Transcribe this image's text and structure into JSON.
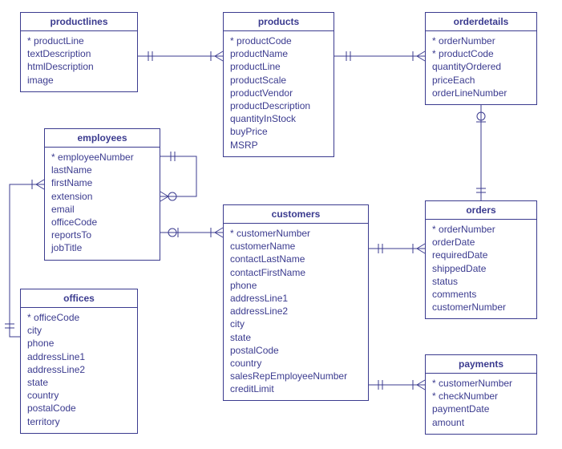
{
  "entities": {
    "productlines": {
      "title": "productlines",
      "fields": [
        {
          "name": "productLine",
          "pk": true
        },
        {
          "name": "textDescription",
          "pk": false
        },
        {
          "name": "htmlDescription",
          "pk": false
        },
        {
          "name": "image",
          "pk": false
        }
      ]
    },
    "products": {
      "title": "products",
      "fields": [
        {
          "name": "productCode",
          "pk": true
        },
        {
          "name": "productName",
          "pk": false
        },
        {
          "name": "productLine",
          "pk": false
        },
        {
          "name": "productScale",
          "pk": false
        },
        {
          "name": "productVendor",
          "pk": false
        },
        {
          "name": "productDescription",
          "pk": false
        },
        {
          "name": "quantityInStock",
          "pk": false
        },
        {
          "name": "buyPrice",
          "pk": false
        },
        {
          "name": "MSRP",
          "pk": false
        }
      ]
    },
    "orderdetails": {
      "title": "orderdetails",
      "fields": [
        {
          "name": "orderNumber",
          "pk": true
        },
        {
          "name": "productCode",
          "pk": true
        },
        {
          "name": "quantityOrdered",
          "pk": false
        },
        {
          "name": "priceEach",
          "pk": false
        },
        {
          "name": "orderLineNumber",
          "pk": false
        }
      ]
    },
    "employees": {
      "title": "employees",
      "fields": [
        {
          "name": "employeeNumber",
          "pk": true
        },
        {
          "name": "lastName",
          "pk": false
        },
        {
          "name": "firstName",
          "pk": false
        },
        {
          "name": "extension",
          "pk": false
        },
        {
          "name": "email",
          "pk": false
        },
        {
          "name": "officeCode",
          "pk": false
        },
        {
          "name": "reportsTo",
          "pk": false
        },
        {
          "name": "jobTitle",
          "pk": false
        }
      ]
    },
    "customers": {
      "title": "customers",
      "fields": [
        {
          "name": "customerNumber",
          "pk": true
        },
        {
          "name": "customerName",
          "pk": false
        },
        {
          "name": "contactLastName",
          "pk": false
        },
        {
          "name": "contactFirstName",
          "pk": false
        },
        {
          "name": "phone",
          "pk": false
        },
        {
          "name": "addressLine1",
          "pk": false
        },
        {
          "name": "addressLine2",
          "pk": false
        },
        {
          "name": "city",
          "pk": false
        },
        {
          "name": "state",
          "pk": false
        },
        {
          "name": "postalCode",
          "pk": false
        },
        {
          "name": "country",
          "pk": false
        },
        {
          "name": "salesRepEmployeeNumber",
          "pk": false
        },
        {
          "name": "creditLimit",
          "pk": false
        }
      ]
    },
    "orders": {
      "title": "orders",
      "fields": [
        {
          "name": "orderNumber",
          "pk": true
        },
        {
          "name": "orderDate",
          "pk": false
        },
        {
          "name": "requiredDate",
          "pk": false
        },
        {
          "name": "shippedDate",
          "pk": false
        },
        {
          "name": "status",
          "pk": false
        },
        {
          "name": "comments",
          "pk": false
        },
        {
          "name": "customerNumber",
          "pk": false
        }
      ]
    },
    "offices": {
      "title": "offices",
      "fields": [
        {
          "name": "officeCode",
          "pk": true
        },
        {
          "name": "city",
          "pk": false
        },
        {
          "name": "phone",
          "pk": false
        },
        {
          "name": "addressLine1",
          "pk": false
        },
        {
          "name": "addressLine2",
          "pk": false
        },
        {
          "name": "state",
          "pk": false
        },
        {
          "name": "country",
          "pk": false
        },
        {
          "name": "postalCode",
          "pk": false
        },
        {
          "name": "territory",
          "pk": false
        }
      ]
    },
    "payments": {
      "title": "payments",
      "fields": [
        {
          "name": "customerNumber",
          "pk": true
        },
        {
          "name": "checkNumber",
          "pk": true
        },
        {
          "name": "paymentDate",
          "pk": false
        },
        {
          "name": "amount",
          "pk": false
        }
      ]
    }
  },
  "relationships": [
    {
      "from": "productlines",
      "to": "products",
      "f_card": "one",
      "t_card": "many"
    },
    {
      "from": "products",
      "to": "orderdetails",
      "f_card": "one",
      "t_card": "many"
    },
    {
      "from": "orderdetails",
      "to": "orders",
      "f_card": "many",
      "t_card": "one"
    },
    {
      "from": "customers",
      "to": "orders",
      "f_card": "one",
      "t_card": "many"
    },
    {
      "from": "customers",
      "to": "payments",
      "f_card": "one",
      "t_card": "many"
    },
    {
      "from": "employees",
      "to": "customers",
      "f_card": "one",
      "t_card": "many"
    },
    {
      "from": "employees",
      "to": "employees",
      "f_card": "one",
      "t_card": "many",
      "self": true
    },
    {
      "from": "offices",
      "to": "employees",
      "f_card": "one",
      "t_card": "many"
    }
  ]
}
